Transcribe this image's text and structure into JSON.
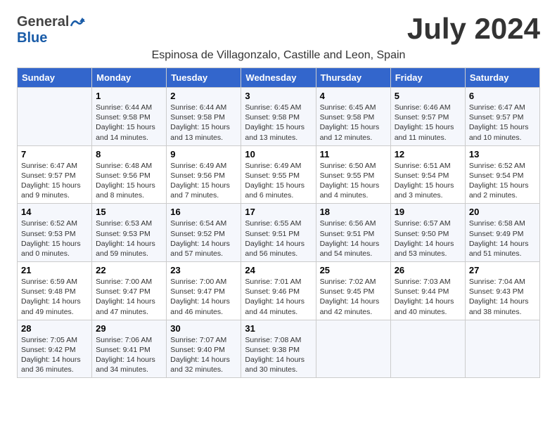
{
  "header": {
    "logo_general": "General",
    "logo_blue": "Blue",
    "month_title": "July 2024",
    "location": "Espinosa de Villagonzalo, Castille and Leon, Spain"
  },
  "days_of_week": [
    "Sunday",
    "Monday",
    "Tuesday",
    "Wednesday",
    "Thursday",
    "Friday",
    "Saturday"
  ],
  "weeks": [
    [
      {
        "day": "",
        "sunrise": "",
        "sunset": "",
        "daylight": ""
      },
      {
        "day": "1",
        "sunrise": "Sunrise: 6:44 AM",
        "sunset": "Sunset: 9:58 PM",
        "daylight": "Daylight: 15 hours and 14 minutes."
      },
      {
        "day": "2",
        "sunrise": "Sunrise: 6:44 AM",
        "sunset": "Sunset: 9:58 PM",
        "daylight": "Daylight: 15 hours and 13 minutes."
      },
      {
        "day": "3",
        "sunrise": "Sunrise: 6:45 AM",
        "sunset": "Sunset: 9:58 PM",
        "daylight": "Daylight: 15 hours and 13 minutes."
      },
      {
        "day": "4",
        "sunrise": "Sunrise: 6:45 AM",
        "sunset": "Sunset: 9:58 PM",
        "daylight": "Daylight: 15 hours and 12 minutes."
      },
      {
        "day": "5",
        "sunrise": "Sunrise: 6:46 AM",
        "sunset": "Sunset: 9:57 PM",
        "daylight": "Daylight: 15 hours and 11 minutes."
      },
      {
        "day": "6",
        "sunrise": "Sunrise: 6:47 AM",
        "sunset": "Sunset: 9:57 PM",
        "daylight": "Daylight: 15 hours and 10 minutes."
      }
    ],
    [
      {
        "day": "7",
        "sunrise": "Sunrise: 6:47 AM",
        "sunset": "Sunset: 9:57 PM",
        "daylight": "Daylight: 15 hours and 9 minutes."
      },
      {
        "day": "8",
        "sunrise": "Sunrise: 6:48 AM",
        "sunset": "Sunset: 9:56 PM",
        "daylight": "Daylight: 15 hours and 8 minutes."
      },
      {
        "day": "9",
        "sunrise": "Sunrise: 6:49 AM",
        "sunset": "Sunset: 9:56 PM",
        "daylight": "Daylight: 15 hours and 7 minutes."
      },
      {
        "day": "10",
        "sunrise": "Sunrise: 6:49 AM",
        "sunset": "Sunset: 9:55 PM",
        "daylight": "Daylight: 15 hours and 6 minutes."
      },
      {
        "day": "11",
        "sunrise": "Sunrise: 6:50 AM",
        "sunset": "Sunset: 9:55 PM",
        "daylight": "Daylight: 15 hours and 4 minutes."
      },
      {
        "day": "12",
        "sunrise": "Sunrise: 6:51 AM",
        "sunset": "Sunset: 9:54 PM",
        "daylight": "Daylight: 15 hours and 3 minutes."
      },
      {
        "day": "13",
        "sunrise": "Sunrise: 6:52 AM",
        "sunset": "Sunset: 9:54 PM",
        "daylight": "Daylight: 15 hours and 2 minutes."
      }
    ],
    [
      {
        "day": "14",
        "sunrise": "Sunrise: 6:52 AM",
        "sunset": "Sunset: 9:53 PM",
        "daylight": "Daylight: 15 hours and 0 minutes."
      },
      {
        "day": "15",
        "sunrise": "Sunrise: 6:53 AM",
        "sunset": "Sunset: 9:53 PM",
        "daylight": "Daylight: 14 hours and 59 minutes."
      },
      {
        "day": "16",
        "sunrise": "Sunrise: 6:54 AM",
        "sunset": "Sunset: 9:52 PM",
        "daylight": "Daylight: 14 hours and 57 minutes."
      },
      {
        "day": "17",
        "sunrise": "Sunrise: 6:55 AM",
        "sunset": "Sunset: 9:51 PM",
        "daylight": "Daylight: 14 hours and 56 minutes."
      },
      {
        "day": "18",
        "sunrise": "Sunrise: 6:56 AM",
        "sunset": "Sunset: 9:51 PM",
        "daylight": "Daylight: 14 hours and 54 minutes."
      },
      {
        "day": "19",
        "sunrise": "Sunrise: 6:57 AM",
        "sunset": "Sunset: 9:50 PM",
        "daylight": "Daylight: 14 hours and 53 minutes."
      },
      {
        "day": "20",
        "sunrise": "Sunrise: 6:58 AM",
        "sunset": "Sunset: 9:49 PM",
        "daylight": "Daylight: 14 hours and 51 minutes."
      }
    ],
    [
      {
        "day": "21",
        "sunrise": "Sunrise: 6:59 AM",
        "sunset": "Sunset: 9:48 PM",
        "daylight": "Daylight: 14 hours and 49 minutes."
      },
      {
        "day": "22",
        "sunrise": "Sunrise: 7:00 AM",
        "sunset": "Sunset: 9:47 PM",
        "daylight": "Daylight: 14 hours and 47 minutes."
      },
      {
        "day": "23",
        "sunrise": "Sunrise: 7:00 AM",
        "sunset": "Sunset: 9:47 PM",
        "daylight": "Daylight: 14 hours and 46 minutes."
      },
      {
        "day": "24",
        "sunrise": "Sunrise: 7:01 AM",
        "sunset": "Sunset: 9:46 PM",
        "daylight": "Daylight: 14 hours and 44 minutes."
      },
      {
        "day": "25",
        "sunrise": "Sunrise: 7:02 AM",
        "sunset": "Sunset: 9:45 PM",
        "daylight": "Daylight: 14 hours and 42 minutes."
      },
      {
        "day": "26",
        "sunrise": "Sunrise: 7:03 AM",
        "sunset": "Sunset: 9:44 PM",
        "daylight": "Daylight: 14 hours and 40 minutes."
      },
      {
        "day": "27",
        "sunrise": "Sunrise: 7:04 AM",
        "sunset": "Sunset: 9:43 PM",
        "daylight": "Daylight: 14 hours and 38 minutes."
      }
    ],
    [
      {
        "day": "28",
        "sunrise": "Sunrise: 7:05 AM",
        "sunset": "Sunset: 9:42 PM",
        "daylight": "Daylight: 14 hours and 36 minutes."
      },
      {
        "day": "29",
        "sunrise": "Sunrise: 7:06 AM",
        "sunset": "Sunset: 9:41 PM",
        "daylight": "Daylight: 14 hours and 34 minutes."
      },
      {
        "day": "30",
        "sunrise": "Sunrise: 7:07 AM",
        "sunset": "Sunset: 9:40 PM",
        "daylight": "Daylight: 14 hours and 32 minutes."
      },
      {
        "day": "31",
        "sunrise": "Sunrise: 7:08 AM",
        "sunset": "Sunset: 9:38 PM",
        "daylight": "Daylight: 14 hours and 30 minutes."
      },
      {
        "day": "",
        "sunrise": "",
        "sunset": "",
        "daylight": ""
      },
      {
        "day": "",
        "sunrise": "",
        "sunset": "",
        "daylight": ""
      },
      {
        "day": "",
        "sunrise": "",
        "sunset": "",
        "daylight": ""
      }
    ]
  ]
}
